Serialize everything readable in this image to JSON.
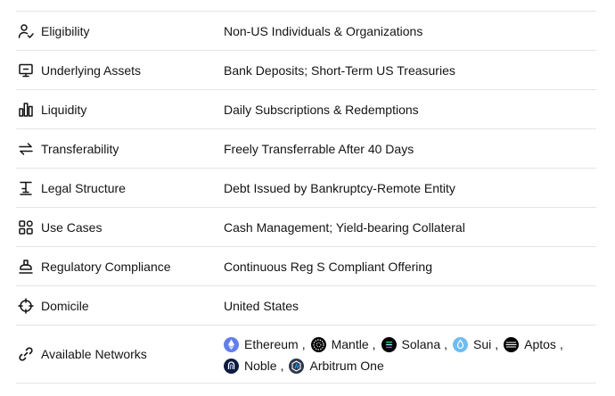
{
  "rows": [
    {
      "icon": "person-check-icon",
      "label": "Eligibility",
      "value": "Non-US Individuals & Organizations"
    },
    {
      "icon": "screen-asset-icon",
      "label": "Underlying Assets",
      "value": "Bank Deposits; Short-Term US Treasuries"
    },
    {
      "icon": "bar-chart-icon",
      "label": "Liquidity",
      "value": "Daily Subscriptions & Redemptions"
    },
    {
      "icon": "transfer-arrows-icon",
      "label": "Transferability",
      "value": "Freely Transferrable After 40 Days"
    },
    {
      "icon": "legal-structure-icon",
      "label": "Legal Structure",
      "value": "Debt Issued by Bankruptcy-Remote Entity"
    },
    {
      "icon": "grid-shapes-icon",
      "label": "Use Cases",
      "value": "Cash Management; Yield-bearing Collateral"
    },
    {
      "icon": "stamp-icon",
      "label": "Regulatory Compliance",
      "value": "Continuous Reg S Compliant Offering"
    },
    {
      "icon": "crosshair-icon",
      "label": "Domicile",
      "value": "United States"
    }
  ],
  "networks_row": {
    "icon": "link-icon",
    "label": "Available Networks",
    "separator": ",",
    "lines": [
      [
        {
          "name": "Ethereum",
          "icon": "ethereum-icon",
          "color": "#627eea"
        },
        {
          "name": "Mantle",
          "icon": "mantle-icon",
          "color": "#000000"
        },
        {
          "name": "Solana",
          "icon": "solana-icon",
          "color": "#000000"
        },
        {
          "name": "Sui",
          "icon": "sui-icon",
          "color": "#6fbcf0"
        },
        {
          "name": "Aptos",
          "icon": "aptos-icon",
          "color": "#000000"
        }
      ],
      [
        {
          "name": "Noble",
          "icon": "noble-icon",
          "color": "#0d1b3e"
        },
        {
          "name": "Arbitrum One",
          "icon": "arbitrum-icon",
          "color": "#2d374b"
        }
      ]
    ]
  }
}
